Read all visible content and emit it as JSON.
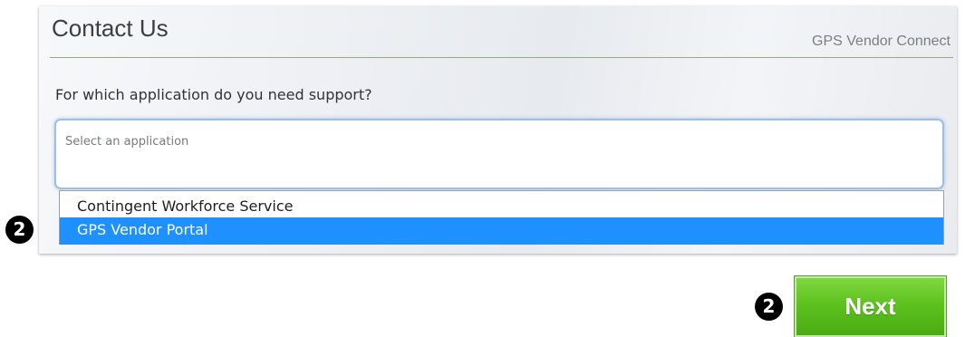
{
  "panel": {
    "title": "Contact Us",
    "app_name": "GPS Vendor Connect"
  },
  "form": {
    "question": "For which application do you need support?",
    "select_placeholder": "Select an application",
    "options": [
      {
        "label": "Contingent Workforce Service",
        "selected": false
      },
      {
        "label": "GPS Vendor Portal",
        "selected": true
      }
    ]
  },
  "callouts": {
    "dropdown_step": "2",
    "next_step": "2"
  },
  "actions": {
    "next_label": "Next"
  },
  "colors": {
    "selected_option": "#1e90ff",
    "next_button": "#5ec21f",
    "divider": "#8fb07a"
  }
}
